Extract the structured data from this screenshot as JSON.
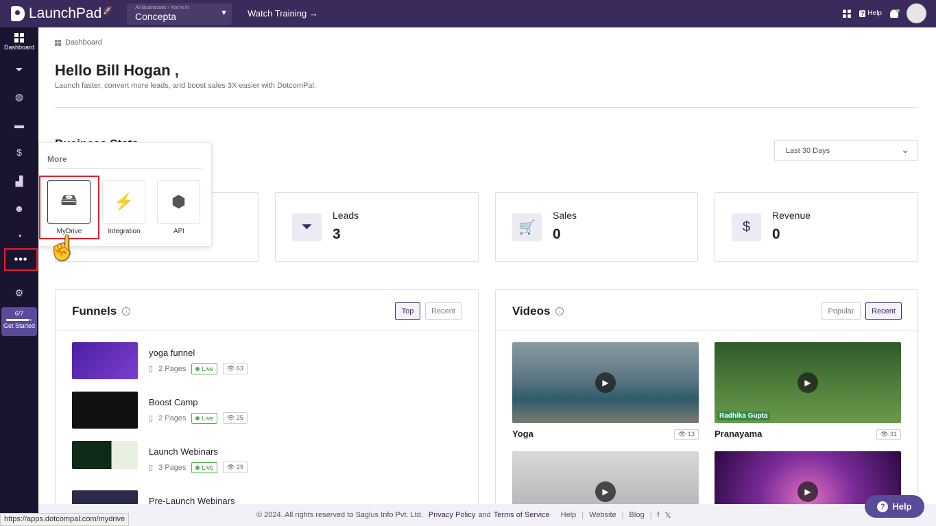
{
  "topbar": {
    "logo_text": "LaunchPad",
    "business_label": "All Businesses › You're In",
    "business_name": "Concepta",
    "watch_training": "Watch Training →",
    "help_label": "Help"
  },
  "sidebar": {
    "dashboard_label": "Dashboard",
    "get_started_progress": "6/7",
    "get_started_label": "Get Started",
    "progress_fraction": 0.857
  },
  "breadcrumb": "Dashboard",
  "greeting": "Hello Bill Hogan ,",
  "subtitle": "Launch faster, convert more leads, and boost sales 3X easier with DotcomPal.",
  "business_stats_title": "Business Stats",
  "date_range": "Last 30 Days",
  "stats": [
    {
      "label": "Leads",
      "value": "3",
      "icon": "leads-funnel-icon"
    },
    {
      "label": "Sales",
      "value": "0",
      "icon": "cart-icon"
    },
    {
      "label": "Revenue",
      "value": "0",
      "icon": "money-bag-icon"
    }
  ],
  "funnels": {
    "title": "Funnels",
    "tabs": [
      "Top",
      "Recent"
    ],
    "items": [
      {
        "name": "yoga funnel",
        "pages": "2 Pages",
        "status": "Live",
        "views": "63"
      },
      {
        "name": "Boost Camp",
        "pages": "2 Pages",
        "status": "Live",
        "views": "25"
      },
      {
        "name": "Launch Webinars",
        "pages": "3 Pages",
        "status": "Live",
        "views": "29"
      },
      {
        "name": "Pre-Launch Webinars"
      }
    ]
  },
  "videos": {
    "title": "Videos",
    "tabs": [
      "Popular",
      "Recent"
    ],
    "items": [
      {
        "title": "Yoga",
        "views": "13"
      },
      {
        "title": "Pranayama",
        "views": "31",
        "overlay": "Radhika Gupta"
      }
    ]
  },
  "more_menu": {
    "title": "More",
    "items": [
      {
        "label": "MyDrive",
        "icon": "drive-icon"
      },
      {
        "label": "Integration",
        "icon": "plug-icon"
      },
      {
        "label": "API",
        "icon": "cube-icon"
      }
    ]
  },
  "footer": {
    "copyright": "© 2024. All rights reserved to Saglus Info Pvt. Ltd.",
    "privacy": "Privacy Policy",
    "and": "and",
    "terms": "Terms of Service",
    "links": [
      "Help",
      "Website",
      "Blog"
    ]
  },
  "status_url": "https://apps.dotcompal.com/mydrive",
  "help_button": "Help",
  "colors": {
    "brand": "#3b2a5c",
    "sidebar": "#1a1430",
    "highlight": "#e3202a",
    "live": "#58b055"
  }
}
